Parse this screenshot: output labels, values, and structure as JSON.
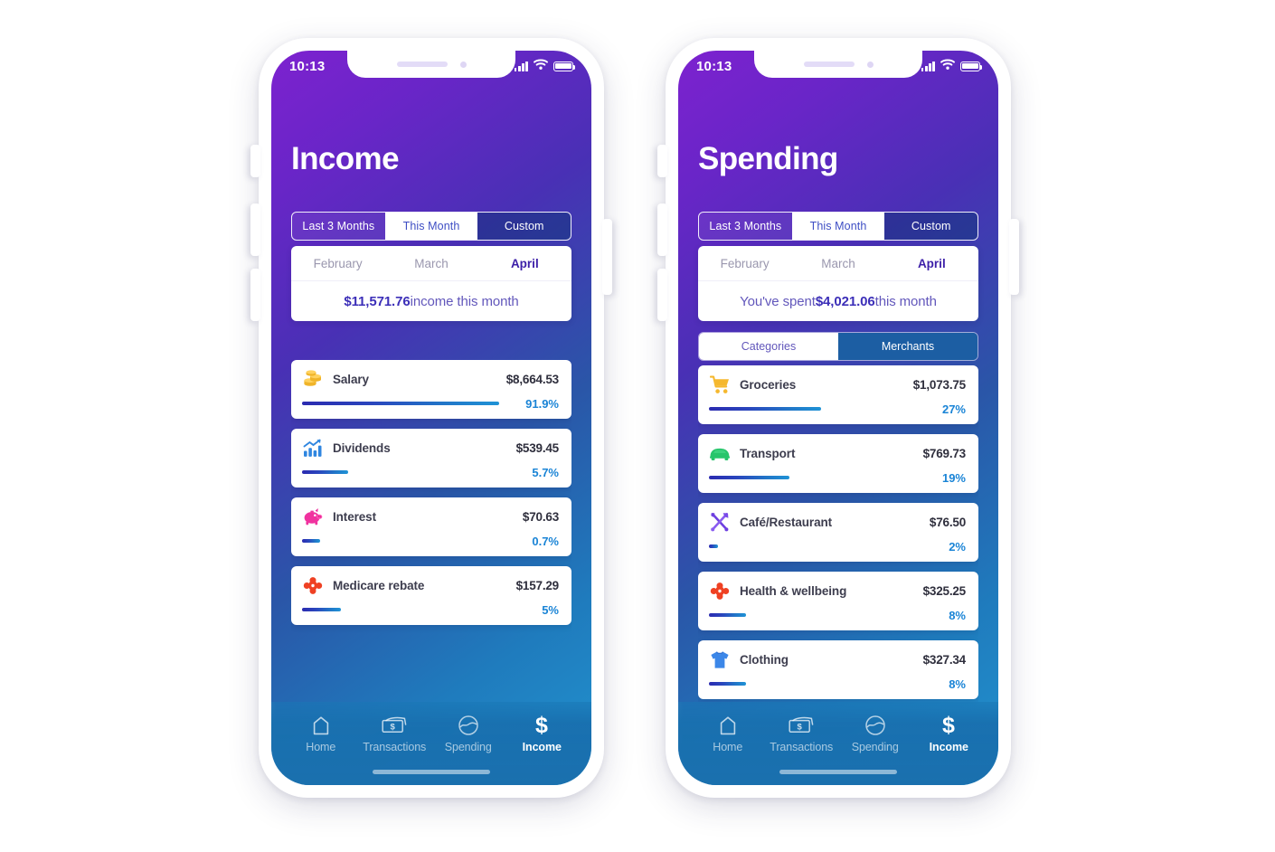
{
  "theme": {
    "gradient_from": "#7d22cf",
    "gradient_to": "#2293cf",
    "accent_blue": "#1a84d6",
    "accent_purple": "#3c2fb8",
    "bar_from": "#2b2bb0",
    "bar_to": "#1f93d6"
  },
  "status_bar": {
    "time": "10:13",
    "cellular_icon": "cellular-bars-icon",
    "wifi_icon": "wifi-icon",
    "battery_icon": "battery-icon"
  },
  "phones": [
    {
      "id": "income",
      "title": "Income",
      "range_tabs": [
        {
          "label": "Last 3 Months",
          "state": "inactive"
        },
        {
          "label": "This Month",
          "state": "active"
        },
        {
          "label": "Custom",
          "state": "inactive"
        }
      ],
      "months": [
        {
          "label": "February",
          "state": "inactive"
        },
        {
          "label": "March",
          "state": "inactive"
        },
        {
          "label": "April",
          "state": "active"
        }
      ],
      "summary": {
        "prefix": "",
        "amount": "$11,571.76",
        "suffix": " income this month"
      },
      "sub_tabs": null,
      "items": [
        {
          "icon": "coins-icon",
          "name": "Salary",
          "amount": "$8,664.53",
          "percent": "91.9%",
          "bar_pct": 91.9
        },
        {
          "icon": "bar-chart-icon",
          "name": "Dividends",
          "amount": "$539.45",
          "percent": "5.7%",
          "bar_pct": 21
        },
        {
          "icon": "piggy-bank-icon",
          "name": "Interest",
          "amount": "$70.63",
          "percent": "0.7%",
          "bar_pct": 8
        },
        {
          "icon": "medical-cross-icon",
          "name": "Medicare rebate",
          "amount": "$157.29",
          "percent": "5%",
          "bar_pct": 17
        }
      ]
    },
    {
      "id": "spending",
      "title": "Spending",
      "range_tabs": [
        {
          "label": "Last 3 Months",
          "state": "inactive"
        },
        {
          "label": "This Month",
          "state": "active"
        },
        {
          "label": "Custom",
          "state": "inactive"
        }
      ],
      "months": [
        {
          "label": "February",
          "state": "inactive"
        },
        {
          "label": "March",
          "state": "inactive"
        },
        {
          "label": "April",
          "state": "active"
        }
      ],
      "summary": {
        "prefix": "You've spent ",
        "amount": "$4,021.06",
        "suffix": " this month"
      },
      "sub_tabs": [
        {
          "label": "Categories",
          "state": "active"
        },
        {
          "label": "Merchants",
          "state": "inactive"
        }
      ],
      "items": [
        {
          "icon": "shopping-cart-icon",
          "name": "Groceries",
          "amount": "$1,073.75",
          "percent": "27%",
          "bar_pct": 50
        },
        {
          "icon": "car-icon",
          "name": "Transport",
          "amount": "$769.73",
          "percent": "19%",
          "bar_pct": 36
        },
        {
          "icon": "cutlery-icon",
          "name": "Café/Restaurant",
          "amount": "$76.50",
          "percent": "2%",
          "bar_pct": 4
        },
        {
          "icon": "medical-cross-icon",
          "name": "Health & wellbeing",
          "amount": "$325.25",
          "percent": "8%",
          "bar_pct": 16
        },
        {
          "icon": "tshirt-icon",
          "name": "Clothing",
          "amount": "$327.34",
          "percent": "8%",
          "bar_pct": 16
        }
      ]
    }
  ],
  "bottom_nav": [
    {
      "icon": "home-icon",
      "label": "Home",
      "state": "inactive"
    },
    {
      "icon": "banknote-icon",
      "label": "Transactions",
      "state": "inactive"
    },
    {
      "icon": "spending-circle-icon",
      "label": "Spending",
      "state": "inactive"
    },
    {
      "icon": "dollar-icon",
      "label": "Income",
      "state": "active"
    }
  ]
}
